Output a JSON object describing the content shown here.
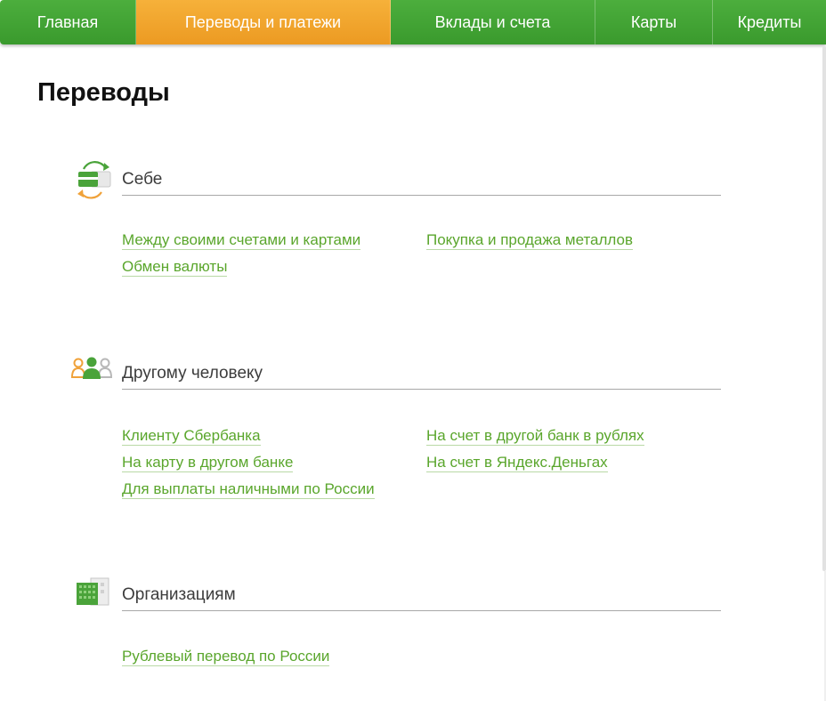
{
  "nav": {
    "tabs": [
      {
        "label": "Главная"
      },
      {
        "label": "Переводы и платежи",
        "active": true
      },
      {
        "label": "Вклады и счета"
      },
      {
        "label": "Карты"
      },
      {
        "label": "Кредиты"
      }
    ]
  },
  "page": {
    "title": "Переводы"
  },
  "sections": [
    {
      "title": "Себе",
      "icon": "card-exchange-icon",
      "links": [
        "Между своими счетами и картами",
        "Покупка и продажа металлов",
        "Обмен валюты"
      ]
    },
    {
      "title": "Другому человеку",
      "icon": "people-icon",
      "links": [
        "Клиенту Сбербанка",
        "На счет в другой банк в рублях",
        "На карту в другом банке",
        "На счет в Яндекс.Деньгах",
        "Для выплаты наличными по России"
      ]
    },
    {
      "title": "Организациям",
      "icon": "building-icon",
      "links": [
        "Рублевый перевод по России"
      ]
    }
  ],
  "colors": {
    "nav_green": "#3a9a2d",
    "nav_active_orange": "#ec9a22",
    "link_green": "#5aa62c"
  }
}
